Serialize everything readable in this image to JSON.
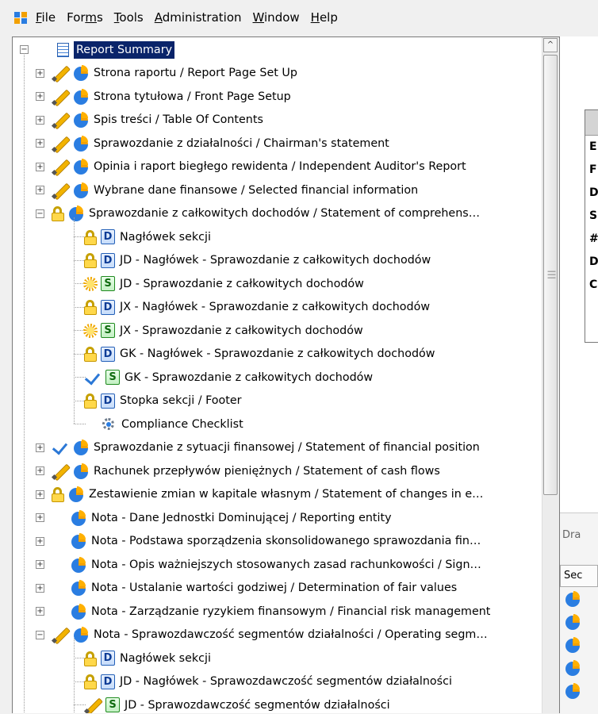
{
  "menu": [
    {
      "label": "File",
      "key": "F"
    },
    {
      "label": "Forms",
      "key": "m"
    },
    {
      "label": "Tools",
      "key": "T"
    },
    {
      "label": "Administration",
      "key": "A"
    },
    {
      "label": "Window",
      "key": "W"
    },
    {
      "label": "Help",
      "key": "H"
    }
  ],
  "tree": [
    {
      "label": "Report Summary",
      "level": 0,
      "status": "none",
      "icon": "report",
      "expander": "minus",
      "selected": true
    },
    {
      "label": "Strona raportu / Report Page Set Up",
      "level": 1,
      "status": "pencil",
      "icon": "pie",
      "expander": "plus"
    },
    {
      "label": "Strona tytułowa / Front Page Setup",
      "level": 1,
      "status": "pencil",
      "icon": "pie",
      "expander": "plus"
    },
    {
      "label": "Spis treści / Table Of Contents",
      "level": 1,
      "status": "pencil",
      "icon": "pie",
      "expander": "plus"
    },
    {
      "label": "Sprawozdanie z działalności / Chairman's statement",
      "level": 1,
      "status": "pencil",
      "icon": "pie",
      "expander": "plus"
    },
    {
      "label": "Opinia i raport biegłego rewidenta / Independent Auditor's Report",
      "level": 1,
      "status": "pencil",
      "icon": "pie",
      "expander": "plus"
    },
    {
      "label": "Wybrane dane finansowe / Selected financial information",
      "level": 1,
      "status": "pencil",
      "icon": "pie",
      "expander": "plus"
    },
    {
      "label": "Sprawozdanie z całkowitych dochodów / Statement of comprehens…",
      "level": 1,
      "status": "lock",
      "icon": "pie",
      "expander": "minus"
    },
    {
      "label": "Nagłówek sekcji",
      "level": 2,
      "status": "lock",
      "icon": "D"
    },
    {
      "label": "JD - Nagłówek - Sprawozdanie z całkowitych dochodów",
      "level": 2,
      "status": "lock",
      "icon": "D"
    },
    {
      "label": "JD - Sprawozdanie z całkowitych dochodów",
      "level": 2,
      "status": "sun",
      "icon": "S"
    },
    {
      "label": "JX - Nagłówek - Sprawozdanie z całkowitych dochodów",
      "level": 2,
      "status": "lock",
      "icon": "D"
    },
    {
      "label": "JX - Sprawozdanie z całkowitych dochodów",
      "level": 2,
      "status": "sun",
      "icon": "S"
    },
    {
      "label": "GK - Nagłówek - Sprawozdanie z całkowitych dochodów",
      "level": 2,
      "status": "lock",
      "icon": "D"
    },
    {
      "label": "GK - Sprawozdanie z całkowitych dochodów",
      "level": 2,
      "status": "check",
      "icon": "S"
    },
    {
      "label": "Stopka sekcji / Footer",
      "level": 2,
      "status": "lock",
      "icon": "D"
    },
    {
      "label": "Compliance Checklist",
      "level": 2,
      "status": "none",
      "icon": "gear"
    },
    {
      "label": "Sprawozdanie z sytuacji finansowej / Statement of financial position",
      "level": 1,
      "status": "check",
      "icon": "pie",
      "expander": "plus"
    },
    {
      "label": "Rachunek przepływów pieniężnych / Statement of cash flows",
      "level": 1,
      "status": "pencil",
      "icon": "pie",
      "expander": "plus"
    },
    {
      "label": "Zestawienie zmian w kapitale własnym / Statement of changes in e…",
      "level": 1,
      "status": "lock",
      "icon": "pie",
      "expander": "plus"
    },
    {
      "label": "Nota - Dane Jednostki Dominującej / Reporting entity",
      "level": 1,
      "status": "none",
      "icon": "pie",
      "expander": "plus"
    },
    {
      "label": "Nota - Podstawa sporządzenia skonsolidowanego sprawozdania fin…",
      "level": 1,
      "status": "none",
      "icon": "pie",
      "expander": "plus"
    },
    {
      "label": "Nota - Opis ważniejszych stosowanych zasad rachunkowości / Sign…",
      "level": 1,
      "status": "none",
      "icon": "pie",
      "expander": "plus"
    },
    {
      "label": "Nota - Ustalanie wartości godziwej / Determination of fair values",
      "level": 1,
      "status": "none",
      "icon": "pie",
      "expander": "plus"
    },
    {
      "label": "Nota - Zarządzanie ryzykiem finansowym / Financial risk management",
      "level": 1,
      "status": "none",
      "icon": "pie",
      "expander": "plus"
    },
    {
      "label": "Nota - Sprawozdawczość segmentów działalności / Operating segm…",
      "level": 1,
      "status": "pencil",
      "icon": "pie",
      "expander": "minus"
    },
    {
      "label": "Nagłówek sekcji",
      "level": 2,
      "status": "lock",
      "icon": "D"
    },
    {
      "label": "JD - Nagłówek - Sprawozdawczość segmentów działalności",
      "level": 2,
      "status": "lock",
      "icon": "D"
    },
    {
      "label": "JD - Sprawozdawczość segmentów działalności",
      "level": 2,
      "status": "pencil",
      "icon": "S"
    }
  ],
  "right_panel": {
    "grid_letters": [
      "E",
      "F",
      "D",
      "S",
      "#",
      "D",
      "C"
    ],
    "drag_label": "Dra",
    "section_header": "Sec"
  },
  "scrollbar": {
    "up_glyph": "^"
  }
}
